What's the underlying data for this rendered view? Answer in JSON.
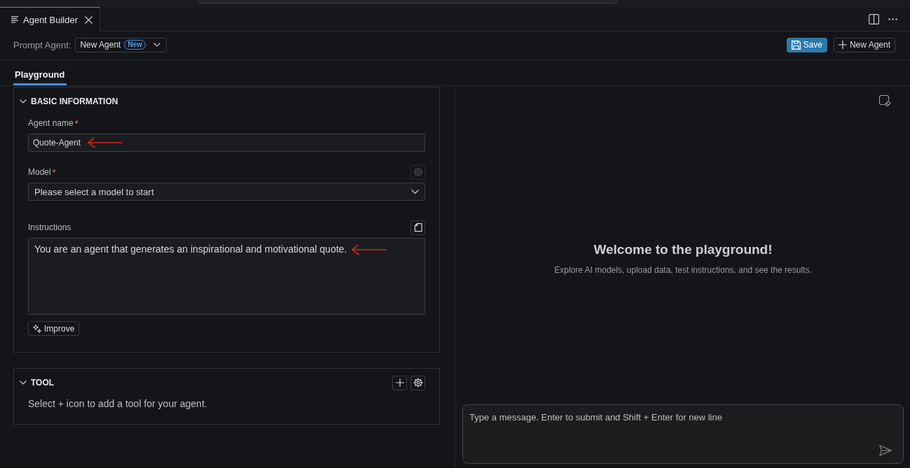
{
  "editor_tabs": [
    {
      "label": "Agent Builder",
      "selected": true
    }
  ],
  "toolbar": {
    "label": "Prompt Agent:",
    "agent_select": {
      "value": "New Agent",
      "badge": "New"
    },
    "buttons": [
      {
        "kind": "save",
        "label": "Save"
      },
      {
        "kind": "new",
        "label": "New Agent"
      }
    ]
  },
  "view_tabs": [
    {
      "label": "Playground",
      "selected": true
    }
  ],
  "sections": [
    {
      "title": "BASIC INFORMATION",
      "expanded": true,
      "fields": [
        {
          "kind": "text",
          "label": "Agent name",
          "required_mark": "*",
          "value": "Quote-Agent",
          "arrow_annotation": true
        },
        {
          "kind": "select",
          "label": "Model",
          "required_mark": "*",
          "action": {
            "kind": "settings",
            "disabled": true
          },
          "value": "Please select a model to start",
          "arrow_annotation": false
        },
        {
          "kind": "textarea",
          "label": "Instructions",
          "action": {
            "kind": "clipboard",
            "disabled": false
          },
          "value": "You are an agent that generates an inspirational and motivational quote.",
          "arrow_annotation": true
        }
      ],
      "buttons": [
        {
          "kind": "improve",
          "label": "Improve"
        }
      ]
    },
    {
      "title": "TOOL",
      "expanded": true,
      "actions": [
        {
          "kind": "add",
          "disabled": false
        },
        {
          "kind": "settings",
          "disabled": false
        }
      ],
      "hint": "Select + icon to add a tool for your agent."
    }
  ],
  "playground": {
    "title": "Welcome to the playground!",
    "subtitle": "Explore AI models, upload data, test instructions, and see the results.",
    "composer": {
      "placeholder": "Type a message. Enter to submit and Shift + Enter for new line"
    }
  }
}
